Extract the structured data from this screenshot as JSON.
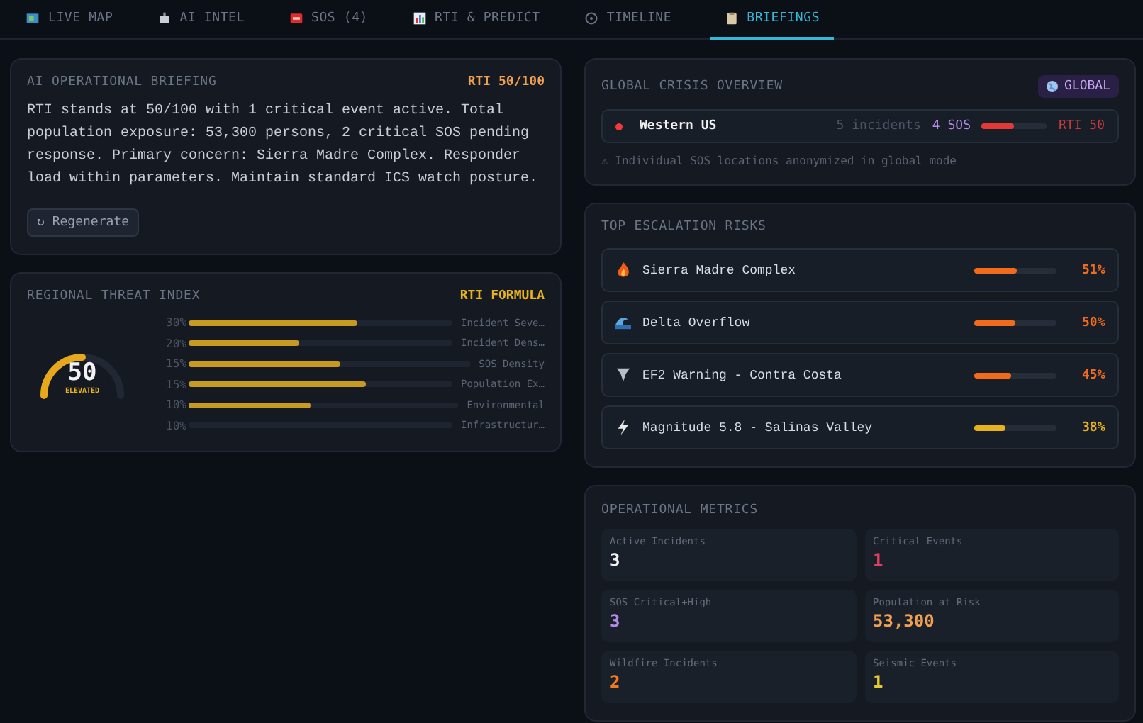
{
  "tabs": [
    {
      "label": "LIVE MAP",
      "selected": false
    },
    {
      "label": "AI INTEL",
      "selected": false
    },
    {
      "label": "SOS (4)",
      "selected": false
    },
    {
      "label": "RTI & PREDICT",
      "selected": false
    },
    {
      "label": "TIMELINE",
      "selected": false
    },
    {
      "label": "BRIEFINGS",
      "selected": true
    }
  ],
  "briefing": {
    "title": "AI OPERATIONAL BRIEFING",
    "badge": "RTI 50/100",
    "text": "RTI stands at 50/100 with 1 critical event active. Total population exposure: 53,300 persons, 2 critical SOS pending response. Primary concern: Sierra Madre Complex. Responder load within parameters. Maintain standard ICS watch posture.",
    "button": "↻ Regenerate"
  },
  "threat_index": {
    "title": "REGIONAL THREAT INDEX",
    "link": "RTI FORMULA",
    "gauge": {
      "value": "50",
      "status": "ELEVATED",
      "level": 0.5
    },
    "factors": [
      {
        "weight": "30%",
        "level": 0.64,
        "label": "Incident Seve…"
      },
      {
        "weight": "20%",
        "level": 0.42,
        "label": "Incident Dens…"
      },
      {
        "weight": "15%",
        "level": 0.54,
        "label": "SOS Density"
      },
      {
        "weight": "15%",
        "level": 0.67,
        "label": "Population Ex…"
      },
      {
        "weight": "10%",
        "level": 0.45,
        "label": "Environmental"
      },
      {
        "weight": "10%",
        "level": 0,
        "label": "Infrastructur…"
      }
    ]
  },
  "global_overview": {
    "title": "GLOBAL CRISIS OVERVIEW",
    "badge": "GLOBAL",
    "regions": [
      {
        "name": "Western US",
        "color": "#ef3b3b",
        "incidents": "5 incidents",
        "sos": "4 SOS",
        "level": 0.5,
        "rti": "RTI 50"
      }
    ],
    "note": "⚠ Individual SOS locations anonymized in global mode"
  },
  "escalation_risks": {
    "title": "TOP ESCALATION RISKS",
    "items": [
      {
        "kind": "fire",
        "name": "Sierra Madre Complex",
        "level": 0.51,
        "percent": "51%",
        "color": "#f26b1d"
      },
      {
        "kind": "flood",
        "name": "Delta Overflow",
        "level": 0.5,
        "percent": "50%",
        "color": "#f26b1d"
      },
      {
        "kind": "tornado",
        "name": "EF2 Warning - Contra Costa",
        "level": 0.45,
        "percent": "45%",
        "color": "#f26b1d"
      },
      {
        "kind": "quake",
        "name": "Magnitude 5.8 - Salinas Valley",
        "level": 0.38,
        "percent": "38%",
        "color": "#e8b21c"
      }
    ]
  },
  "metrics": {
    "title": "OPERATIONAL METRICS",
    "items": [
      {
        "label": "Active Incidents",
        "value": "3",
        "color": "#f2f2f2"
      },
      {
        "label": "Critical Events",
        "value": "1",
        "color": "#e0405a"
      },
      {
        "label": "SOS Critical+High",
        "value": "3",
        "color": "#b38ae8"
      },
      {
        "label": "Population at Risk",
        "value": "53,300",
        "color": "#f0a050"
      },
      {
        "label": "Wildfire Incidents",
        "value": "2",
        "color": "#f07a20"
      },
      {
        "label": "Seismic Events",
        "value": "1",
        "color": "#e8c830"
      }
    ]
  }
}
